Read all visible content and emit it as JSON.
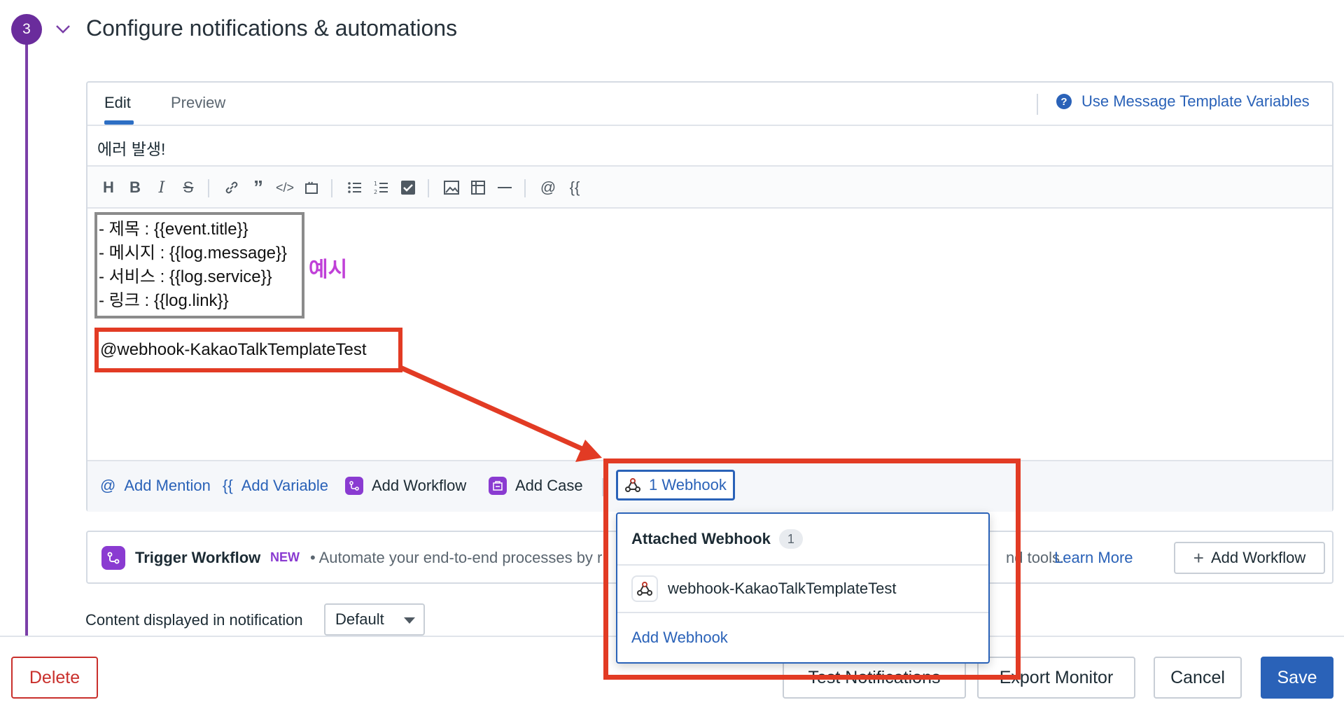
{
  "step": {
    "number": "3",
    "title": "Configure notifications & automations"
  },
  "editor": {
    "tabs": [
      {
        "label": "Edit"
      },
      {
        "label": "Preview"
      }
    ],
    "template_link": "Use Message Template Variables",
    "subject": "에러 발생!",
    "toolbar_icons": [
      "heading-icon",
      "bold-icon",
      "italic-icon",
      "strikethrough-icon",
      "link-icon",
      "quote-icon",
      "code-icon",
      "code-block-icon",
      "bullet-list-icon",
      "numbered-list-icon",
      "checklist-icon",
      "image-icon",
      "table-icon",
      "horizontal-rule-icon",
      "mention-icon",
      "variable-icon"
    ],
    "body_lines": [
      "- 제목 : {{event.title}}",
      "- 메시지 : {{log.message}}",
      "- 서비스 : {{log.service}}",
      "- 링크 : {{log.link}}"
    ],
    "example_label": "예시",
    "mention": "@webhook-KakaoTalkTemplateTest",
    "footer": {
      "add_mention": "Add Mention",
      "add_variable": "Add Variable",
      "add_workflow": "Add Workflow",
      "add_case": "Add Case",
      "webhook_button": "1 Webhook"
    }
  },
  "trigger": {
    "title": "Trigger Workflow",
    "badge": "NEW",
    "description": "•  Automate your end-to-end processes by r",
    "description_tail": "nd tools.",
    "learn_more": "Learn More",
    "add_workflow": "Add Workflow"
  },
  "content": {
    "label": "Content displayed in notification",
    "selected": "Default"
  },
  "bottom": {
    "delete": "Delete",
    "test_notifications": "Test Notifications",
    "export_monitor": "Export Monitor",
    "cancel": "Cancel",
    "save": "Save"
  },
  "dropdown": {
    "header": "Attached Webhook",
    "count": "1",
    "item": "webhook-KakaoTalkTemplateTest",
    "add": "Add Webhook"
  },
  "colors": {
    "accent": "#2a62b8",
    "step": "#6a2c9c",
    "annotation": "#e23b24",
    "example": "#c040d8"
  }
}
